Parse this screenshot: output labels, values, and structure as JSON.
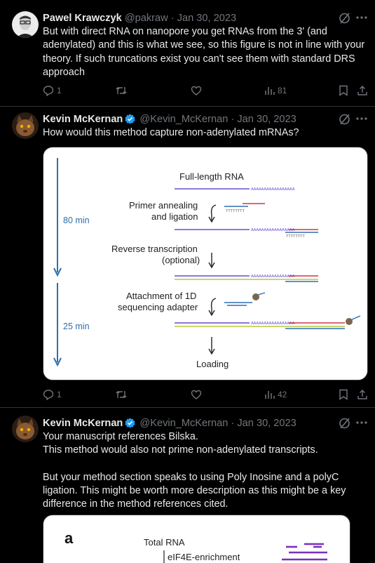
{
  "tweets": [
    {
      "name": "Pawel Krawczyk",
      "handle": "@pakraw",
      "date": "Jan 30, 2023",
      "text": "But with direct RNA on nanopore you get RNAs from the 3' (and adenylated) and this is what we see, so this figure is not in line with your theory. If such truncations exist you can't see them with standard DRS approach",
      "replies": "1",
      "views": "81"
    },
    {
      "name": "Kevin McKernan",
      "handle": "@Kevin_McKernan",
      "date": "Jan 30, 2023",
      "text": "How would this method capture non-adenylated mRNAs?",
      "replies": "1",
      "views": "42"
    },
    {
      "name": "Kevin McKernan",
      "handle": "@Kevin_McKernan",
      "date": "Jan 30, 2023",
      "text": "Your manuscript references Bilska.\nThis method would also not prime non-adenylated transcripts.\n\nBut your method section speaks to using Poly Inosine and a polyC ligation. This might be worth more description as this might be a key difference in the method references cited."
    }
  ],
  "figure1": {
    "full_length": "Full-length RNA",
    "primer_1": "Primer annealing",
    "primer_2": "and ligation",
    "rt_1": "Reverse transcription",
    "rt_2": "(optional)",
    "attach_1": "Attachment of 1D",
    "attach_2": "sequencing adapter",
    "loading": "Loading",
    "time_1": "80 min",
    "time_2": "25 min",
    "poly_a": "AAAAAAAAAAAAAAAAA",
    "poly_t": "TTTTTTTT"
  },
  "figure2": {
    "panel": "a",
    "total_rna": "Total RNA",
    "enrich": "eIF4E-enrichment"
  },
  "colors": {
    "rna": "#6a4bd1",
    "cdna": "#b7c93a",
    "primer": "#d0344d",
    "adapter": "#2e6db5",
    "timeline": "#2f6fa8",
    "purple": "#7b2fbf"
  }
}
